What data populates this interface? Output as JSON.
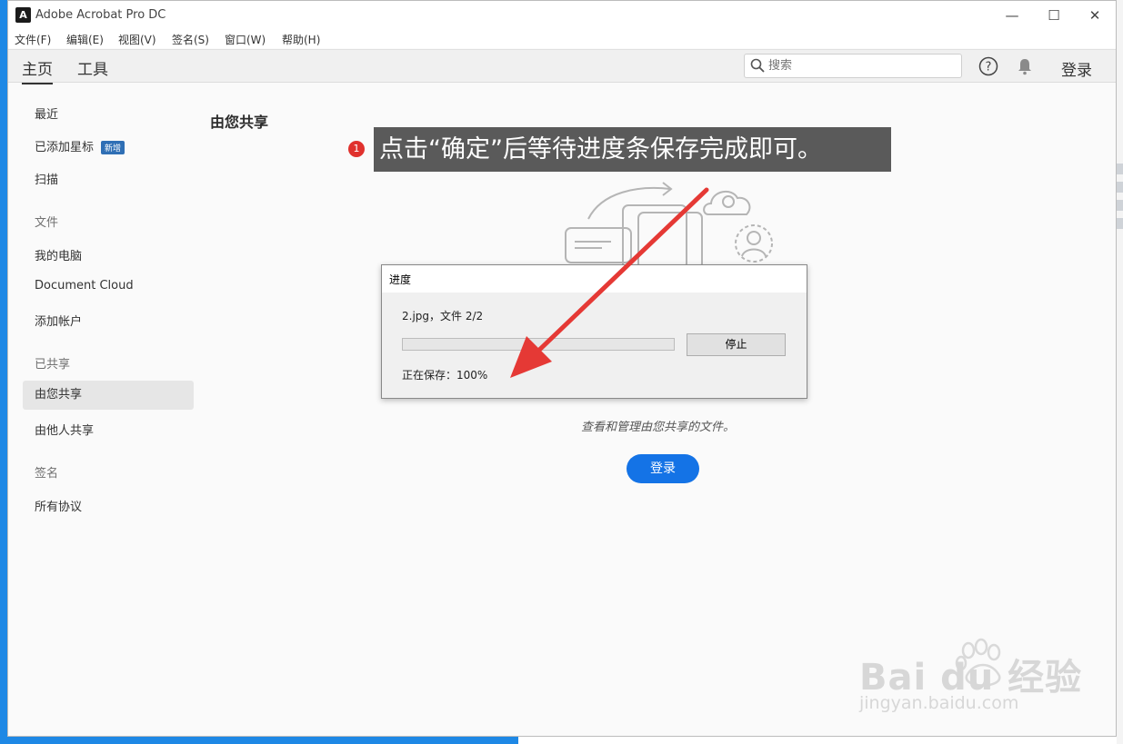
{
  "window": {
    "title": "Adobe Acrobat Pro DC",
    "minimize": "—",
    "maximize": "☐",
    "close": "✕"
  },
  "menu": [
    "文件(F)",
    "编辑(E)",
    "视图(V)",
    "签名(S)",
    "窗口(W)",
    "帮助(H)"
  ],
  "topnav": {
    "tabs": [
      "主页",
      "工具"
    ],
    "active_tab": "主页",
    "search_placeholder": "搜索",
    "signin": "登录"
  },
  "sidebar": {
    "recent": "最近",
    "starred": "已添加星标",
    "starred_badge": "新增",
    "scan": "扫描",
    "files_header": "文件",
    "my_computer": "我的电脑",
    "document_cloud": "Document Cloud",
    "add_account": "添加帐户",
    "shared_header": "已共享",
    "shared_by_you": "由您共享",
    "shared_by_others": "由他人共享",
    "sign_header": "签名",
    "all_agreements": "所有协议"
  },
  "main": {
    "title": "由您共享",
    "description": "查看和管理由您共享的文件。",
    "signin_button": "登录"
  },
  "dialog": {
    "title": "进度",
    "file_status": "2.jpg，文件 2/2",
    "progress_percent": 100,
    "stop_button": "停止",
    "save_status": "正在保存：100%"
  },
  "annotation": {
    "step_number": "1",
    "text": "点击“确定”后等待进度条保存完成即可。"
  },
  "watermark": {
    "brand": "Bai du 经验",
    "url": "jingyan.baidu.com"
  },
  "colors": {
    "accent": "#1473e6",
    "callout_bg": "#5a5a5a",
    "arrow": "#e53935",
    "badge": "#2f6fb5"
  }
}
